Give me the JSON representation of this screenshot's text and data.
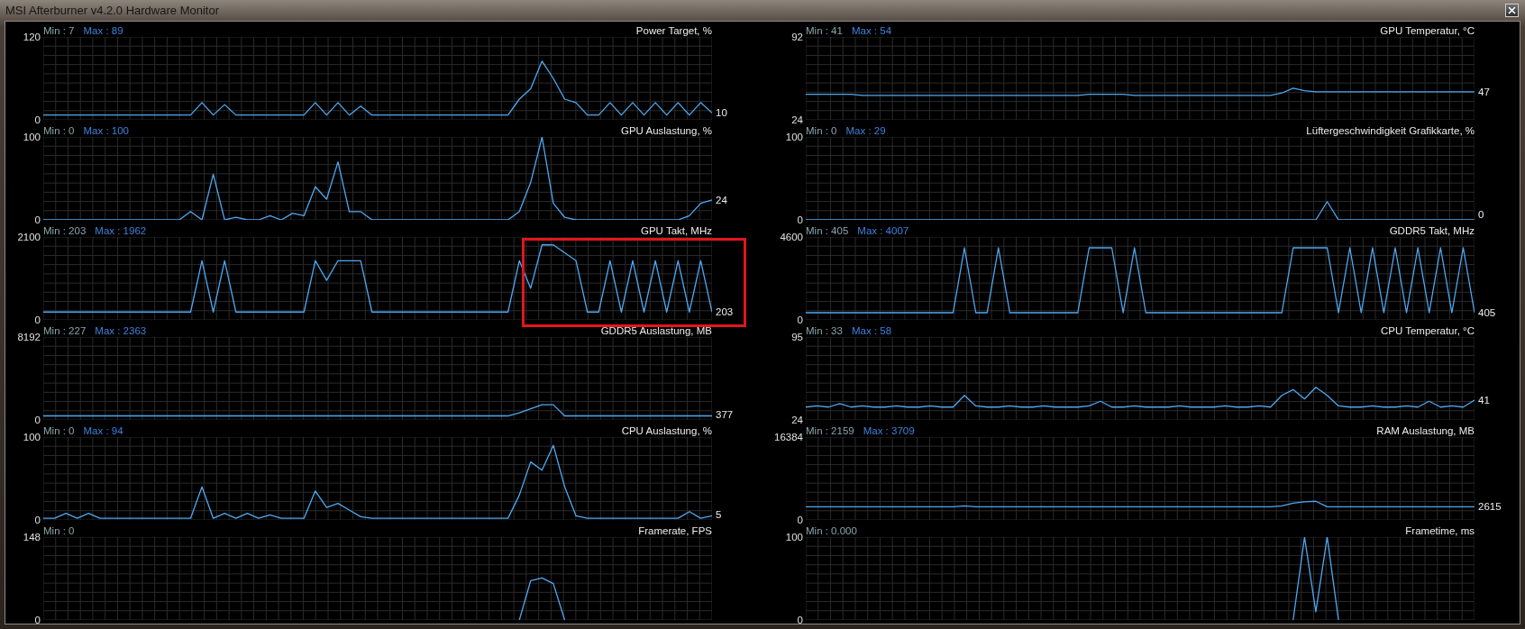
{
  "window": {
    "title": "MSI Afterburner v4.2.0 Hardware Monitor"
  },
  "columns": [
    {
      "graphs": [
        {
          "min_label": "Min : 7",
          "max_label": "Max : 89",
          "current": "10",
          "highlighted": false,
          "chart_data": {
            "type": "line",
            "title": "Power Target, %",
            "grid": true,
            "ylim": [
              0,
              120
            ],
            "yticks": [
              0,
              120
            ],
            "series": [
              {
                "color": "#4ea8f2",
                "values": [
                  7,
                  7,
                  7,
                  7,
                  7,
                  7,
                  7,
                  7,
                  7,
                  7,
                  7,
                  7,
                  7,
                  7,
                  25,
                  7,
                  22,
                  7,
                  7,
                  7,
                  7,
                  7,
                  7,
                  7,
                  25,
                  7,
                  25,
                  7,
                  20,
                  7,
                  7,
                  7,
                  7,
                  7,
                  7,
                  7,
                  7,
                  7,
                  7,
                  7,
                  7,
                  7,
                  30,
                  45,
                  85,
                  60,
                  30,
                  25,
                  7,
                  7,
                  25,
                  7,
                  25,
                  7,
                  25,
                  7,
                  25,
                  7,
                  25,
                  10
                ]
              }
            ]
          }
        },
        {
          "min_label": "Min : 0",
          "max_label": "Max : 100",
          "current": "24",
          "highlighted": false,
          "chart_data": {
            "type": "line",
            "title": "GPU Auslastung, %",
            "grid": true,
            "ylim": [
              0,
              100
            ],
            "yticks": [
              0,
              100
            ],
            "series": [
              {
                "color": "#4ea8f2",
                "values": [
                  0,
                  0,
                  0,
                  0,
                  0,
                  0,
                  0,
                  0,
                  0,
                  0,
                  0,
                  0,
                  0,
                  10,
                  0,
                  55,
                  0,
                  3,
                  0,
                  0,
                  5,
                  0,
                  8,
                  5,
                  40,
                  25,
                  70,
                  10,
                  10,
                  0,
                  0,
                  0,
                  0,
                  0,
                  0,
                  0,
                  0,
                  0,
                  0,
                  0,
                  0,
                  0,
                  10,
                  45,
                  100,
                  20,
                  3,
                  0,
                  0,
                  0,
                  0,
                  0,
                  0,
                  0,
                  0,
                  0,
                  0,
                  5,
                  20,
                  24
                ]
              }
            ]
          }
        },
        {
          "min_label": "Min : 203",
          "max_label": "Max : 1962",
          "current": "203",
          "highlighted": true,
          "chart_data": {
            "type": "line",
            "title": "GPU Takt, MHz",
            "grid": true,
            "ylim": [
              0,
              2100
            ],
            "yticks": [
              0,
              2100
            ],
            "series": [
              {
                "color": "#4ea8f2",
                "values": [
                  200,
                  200,
                  200,
                  200,
                  200,
                  200,
                  200,
                  200,
                  200,
                  200,
                  200,
                  200,
                  200,
                  200,
                  1500,
                  200,
                  1500,
                  200,
                  200,
                  200,
                  200,
                  200,
                  200,
                  200,
                  1500,
                  1000,
                  1500,
                  1500,
                  1500,
                  200,
                  200,
                  200,
                  200,
                  200,
                  200,
                  200,
                  200,
                  200,
                  200,
                  200,
                  200,
                  200,
                  1500,
                  800,
                  1900,
                  1900,
                  1700,
                  1500,
                  200,
                  200,
                  1500,
                  200,
                  1500,
                  200,
                  1500,
                  200,
                  1500,
                  200,
                  1500,
                  200
                ]
              }
            ]
          }
        },
        {
          "min_label": "Min : 227",
          "max_label": "Max : 2363",
          "current": "377",
          "highlighted": false,
          "chart_data": {
            "type": "line",
            "title": "GDDR5 Auslastung, MB",
            "grid": true,
            "ylim": [
              0,
              8192
            ],
            "yticks": [
              0,
              8192
            ],
            "series": [
              {
                "color": "#4ea8f2",
                "values": [
                  400,
                  400,
                  400,
                  400,
                  400,
                  400,
                  400,
                  400,
                  400,
                  400,
                  400,
                  400,
                  400,
                  400,
                  400,
                  400,
                  400,
                  400,
                  400,
                  400,
                  400,
                  400,
                  400,
                  400,
                  400,
                  400,
                  400,
                  400,
                  400,
                  400,
                  400,
                  400,
                  400,
                  400,
                  400,
                  400,
                  400,
                  400,
                  400,
                  400,
                  400,
                  400,
                  700,
                  1100,
                  1500,
                  1500,
                  400,
                  400,
                  400,
                  400,
                  400,
                  400,
                  400,
                  400,
                  400,
                  400,
                  400,
                  400,
                  400,
                  400
                ]
              }
            ]
          }
        },
        {
          "min_label": "Min : 0",
          "max_label": "Max : 94",
          "current": "5",
          "highlighted": false,
          "chart_data": {
            "type": "line",
            "title": "CPU Auslastung, %",
            "grid": true,
            "ylim": [
              0,
              100
            ],
            "yticks": [
              0,
              100
            ],
            "series": [
              {
                "color": "#4ea8f2",
                "values": [
                  2,
                  2,
                  8,
                  2,
                  8,
                  2,
                  2,
                  2,
                  2,
                  2,
                  2,
                  2,
                  2,
                  2,
                  40,
                  2,
                  8,
                  2,
                  8,
                  2,
                  6,
                  2,
                  2,
                  2,
                  35,
                  15,
                  20,
                  12,
                  4,
                  2,
                  2,
                  2,
                  2,
                  2,
                  2,
                  2,
                  2,
                  2,
                  2,
                  2,
                  2,
                  2,
                  30,
                  70,
                  60,
                  90,
                  40,
                  5,
                  2,
                  2,
                  2,
                  2,
                  2,
                  2,
                  2,
                  2,
                  2,
                  10,
                  2,
                  5
                ]
              }
            ]
          }
        },
        {
          "min_label": "Min : 0",
          "highlighted": false,
          "chart_data": {
            "type": "line",
            "title": "Framerate, FPS",
            "grid": true,
            "ylim": [
              0,
              148
            ],
            "yticks": [
              0,
              148
            ],
            "series": [
              {
                "color": "#4ea8f2",
                "values": [
                  null,
                  null,
                  null,
                  null,
                  null,
                  null,
                  null,
                  null,
                  null,
                  null,
                  null,
                  null,
                  null,
                  null,
                  null,
                  null,
                  null,
                  null,
                  null,
                  null,
                  null,
                  null,
                  null,
                  null,
                  null,
                  null,
                  null,
                  null,
                  null,
                  null,
                  null,
                  null,
                  null,
                  null,
                  null,
                  null,
                  null,
                  null,
                  null,
                  null,
                  null,
                  null,
                  0,
                  70,
                  75,
                  65,
                  0,
                  null,
                  null,
                  null,
                  null,
                  null,
                  null,
                  null,
                  null,
                  null,
                  null,
                  null,
                  null,
                  null
                ]
              }
            ]
          }
        }
      ]
    },
    {
      "graphs": [
        {
          "min_label": "Min : 41",
          "max_label": "Max : 54",
          "current": "47",
          "highlighted": false,
          "chart_data": {
            "type": "line",
            "title": "GPU Temperatur, °C",
            "grid": true,
            "ylim": [
              24,
              92
            ],
            "yticks": [
              24,
              92
            ],
            "series": [
              {
                "color": "#4ea8f2",
                "values": [
                  45,
                  45,
                  45,
                  45,
                  45,
                  44,
                  44,
                  44,
                  44,
                  44,
                  44,
                  44,
                  44,
                  44,
                  44,
                  44,
                  44,
                  44,
                  44,
                  44,
                  44,
                  44,
                  44,
                  44,
                  44,
                  45,
                  45,
                  45,
                  45,
                  44,
                  44,
                  44,
                  44,
                  44,
                  44,
                  44,
                  44,
                  44,
                  44,
                  44,
                  44,
                  44,
                  46,
                  50,
                  48,
                  47,
                  47,
                  47,
                  47,
                  47,
                  47,
                  47,
                  47,
                  47,
                  47,
                  47,
                  47,
                  47,
                  47,
                  47
                ]
              }
            ]
          }
        },
        {
          "min_label": "Min : 0",
          "max_label": "Max : 29",
          "current": "0",
          "highlighted": false,
          "chart_data": {
            "type": "line",
            "title": "Lüftergeschwindigkeit Grafikkarte, %",
            "grid": true,
            "ylim": [
              0,
              100
            ],
            "yticks": [
              0,
              100
            ],
            "series": [
              {
                "color": "#4ea8f2",
                "values": [
                  0,
                  0,
                  0,
                  0,
                  0,
                  0,
                  0,
                  0,
                  0,
                  0,
                  0,
                  0,
                  0,
                  0,
                  0,
                  0,
                  0,
                  0,
                  0,
                  0,
                  0,
                  0,
                  0,
                  0,
                  0,
                  0,
                  0,
                  0,
                  0,
                  0,
                  0,
                  0,
                  0,
                  0,
                  0,
                  0,
                  0,
                  0,
                  0,
                  0,
                  0,
                  0,
                  0,
                  0,
                  0,
                  0,
                  22,
                  0,
                  0,
                  0,
                  0,
                  0,
                  0,
                  0,
                  0,
                  0,
                  0,
                  0,
                  0,
                  0
                ]
              }
            ]
          }
        },
        {
          "min_label": "Min : 405",
          "max_label": "Max : 4007",
          "current": "405",
          "highlighted": false,
          "chart_data": {
            "type": "line",
            "title": "GDDR5 Takt, MHz",
            "grid": true,
            "ylim": [
              0,
              4600
            ],
            "yticks": [
              0,
              4600
            ],
            "series": [
              {
                "color": "#4ea8f2",
                "values": [
                  400,
                  400,
                  400,
                  400,
                  400,
                  400,
                  400,
                  400,
                  400,
                  400,
                  400,
                  400,
                  400,
                  400,
                  4000,
                  400,
                  400,
                  4000,
                  400,
                  400,
                  400,
                  400,
                  400,
                  400,
                  400,
                  4000,
                  4000,
                  4000,
                  400,
                  4000,
                  400,
                  400,
                  400,
                  400,
                  400,
                  400,
                  400,
                  400,
                  400,
                  400,
                  400,
                  400,
                  400,
                  4000,
                  4000,
                  4000,
                  4000,
                  400,
                  4000,
                  400,
                  4000,
                  400,
                  4000,
                  400,
                  4000,
                  400,
                  4000,
                  400,
                  4000,
                  400
                ]
              }
            ]
          }
        },
        {
          "min_label": "Min : 33",
          "max_label": "Max : 58",
          "current": "41",
          "highlighted": false,
          "chart_data": {
            "type": "line",
            "title": "CPU Temperatur, °C",
            "grid": true,
            "ylim": [
              24,
              95
            ],
            "yticks": [
              24,
              95
            ],
            "series": [
              {
                "color": "#4ea8f2",
                "values": [
                  35,
                  36,
                  35,
                  38,
                  35,
                  36,
                  35,
                  35,
                  36,
                  35,
                  35,
                  36,
                  35,
                  35,
                  45,
                  36,
                  35,
                  35,
                  36,
                  35,
                  35,
                  36,
                  35,
                  35,
                  35,
                  36,
                  40,
                  35,
                  35,
                  36,
                  35,
                  35,
                  35,
                  36,
                  35,
                  35,
                  35,
                  36,
                  35,
                  35,
                  36,
                  35,
                  45,
                  50,
                  42,
                  52,
                  45,
                  36,
                  35,
                  35,
                  36,
                  35,
                  35,
                  36,
                  35,
                  40,
                  35,
                  36,
                  35,
                  41
                ]
              }
            ]
          }
        },
        {
          "min_label": "Min : 2159",
          "max_label": "Max : 3709",
          "current": "2615",
          "highlighted": false,
          "chart_data": {
            "type": "line",
            "title": "RAM Auslastung, MB",
            "grid": true,
            "ylim": [
              0,
              16384
            ],
            "yticks": [
              0,
              16384
            ],
            "series": [
              {
                "color": "#4ea8f2",
                "values": [
                  2600,
                  2600,
                  2600,
                  2600,
                  2600,
                  2600,
                  2600,
                  2600,
                  2600,
                  2600,
                  2600,
                  2600,
                  2600,
                  2600,
                  2800,
                  2600,
                  2600,
                  2600,
                  2600,
                  2600,
                  2600,
                  2600,
                  2600,
                  2600,
                  2600,
                  2600,
                  2600,
                  2600,
                  2600,
                  2600,
                  2600,
                  2600,
                  2600,
                  2600,
                  2600,
                  2600,
                  2600,
                  2600,
                  2600,
                  2600,
                  2600,
                  2600,
                  2800,
                  3300,
                  3600,
                  3700,
                  2600,
                  2600,
                  2600,
                  2600,
                  2600,
                  2600,
                  2600,
                  2600,
                  2600,
                  2600,
                  2600,
                  2600,
                  2600,
                  2600
                ]
              }
            ]
          }
        },
        {
          "min_label": "Min : 0.000",
          "highlighted": false,
          "chart_data": {
            "type": "line",
            "title": "Frametime, ms",
            "grid": true,
            "ylim": [
              0,
              100
            ],
            "yticks": [
              0,
              100
            ],
            "series": [
              {
                "color": "#4ea8f2",
                "values": [
                  null,
                  null,
                  null,
                  null,
                  null,
                  null,
                  null,
                  null,
                  null,
                  null,
                  null,
                  null,
                  null,
                  null,
                  null,
                  null,
                  null,
                  null,
                  null,
                  null,
                  null,
                  null,
                  null,
                  null,
                  null,
                  null,
                  null,
                  null,
                  null,
                  null,
                  null,
                  null,
                  null,
                  null,
                  null,
                  null,
                  null,
                  null,
                  null,
                  null,
                  null,
                  null,
                  null,
                  0,
                  100,
                  10,
                  100,
                  0,
                  null,
                  null,
                  null,
                  null,
                  null,
                  null,
                  null,
                  null,
                  null,
                  null,
                  null,
                  null
                ]
              }
            ]
          }
        }
      ]
    }
  ]
}
